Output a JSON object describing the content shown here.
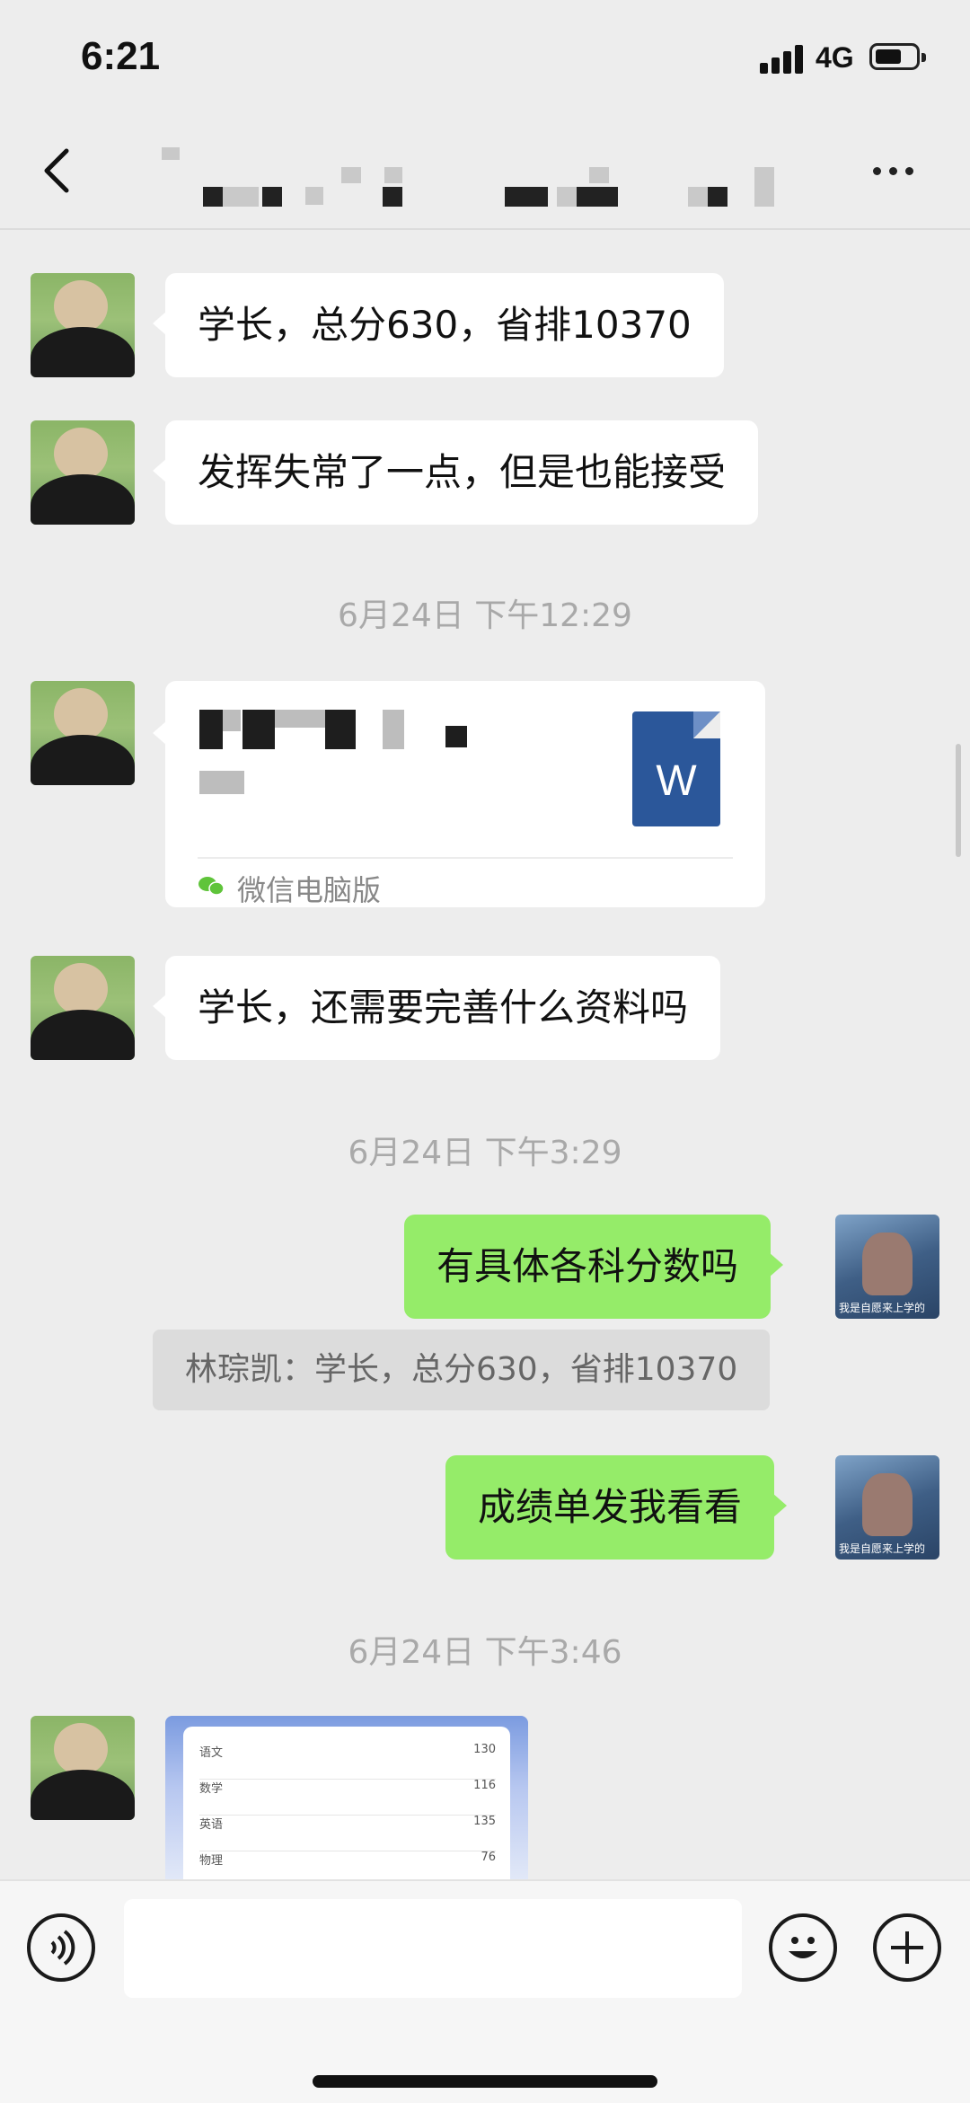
{
  "status_bar": {
    "time": "6:21",
    "network": "4G"
  },
  "nav": {
    "title": ""
  },
  "messages": {
    "m1": "学长，总分630，省排10370",
    "m2": "发挥失常了一点，但是也能接受",
    "ts1": "6月24日 下午12:29",
    "file": {
      "source": "微信电脑版",
      "icon_letter": "W"
    },
    "m3": "学长，还需要完善什么资料吗",
    "ts2": "6月24日 下午3:29",
    "out1": "有具体各科分数吗",
    "quote1": "林琮凯：学长，总分630，省排10370",
    "out2": "成绩单发我看看",
    "ts3": "6月24日 下午3:46",
    "avatar_out_caption": "我是自愿来上学的",
    "scores": [
      {
        "subject": "语文",
        "score": "130"
      },
      {
        "subject": "数学",
        "score": "116"
      },
      {
        "subject": "英语",
        "score": "135"
      },
      {
        "subject": "物理",
        "score": "76"
      }
    ]
  },
  "input_bar": {
    "placeholder": ""
  },
  "icons": [
    "back-chevron-icon",
    "more-dots-icon",
    "voice-icon",
    "emoji-icon",
    "plus-icon",
    "word-file-icon",
    "wechat-icon"
  ]
}
